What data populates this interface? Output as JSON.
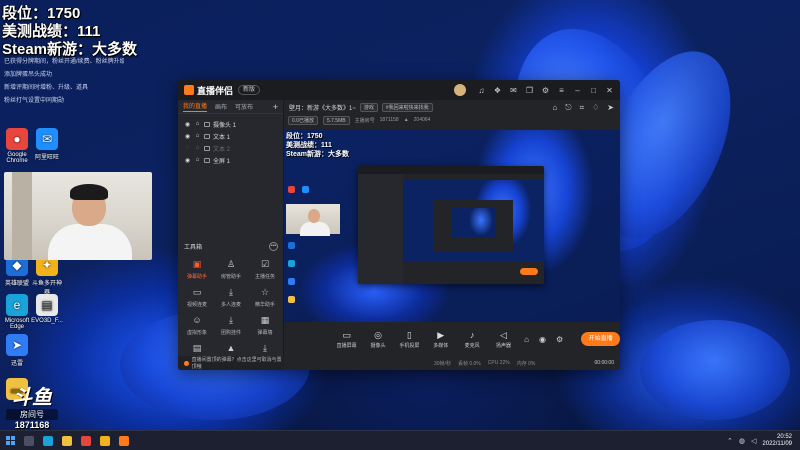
{
  "overlay": {
    "rank": "段位：1750",
    "record": "美测战绩：111",
    "game": "Steam新游：大多数",
    "danmu": [
      "已获得分牌期间，粉丝开通/续费、粉丝牌升级",
      "添加牌蛋吊头成功",
      "新增评期间时增粉、升级、道具",
      "粉丝打气设置中同期勋"
    ]
  },
  "desktop_icons": [
    {
      "label": "Google Chrome",
      "icon": "chrome-icon",
      "color": "#e8453c"
    },
    {
      "label": "阿里旺旺",
      "icon": "chat-icon",
      "color": "#1f8fff"
    },
    {
      "label": "英雄联盟",
      "icon": "game-icon",
      "color": "#1c6ed8"
    },
    {
      "label": "斗鱼多开神器",
      "icon": "fish-icon",
      "color": "#f2b21b"
    },
    {
      "label": "Microsoft Edge",
      "icon": "edge-icon",
      "color": "#1aa3d8"
    },
    {
      "label": "EVO3D_F...",
      "icon": "file-icon",
      "color": "#e8e8e8"
    },
    {
      "label": "迅雷",
      "icon": "bird-icon",
      "color": "#2f7cf5"
    },
    {
      "label": "",
      "icon": "folder-icon",
      "color": "#f0c040"
    }
  ],
  "watermark": {
    "logo": "斗鱼",
    "room_label": "房间号",
    "room_number": "1871168"
  },
  "app": {
    "name": "直播伴侣",
    "version_badge": "新版",
    "tabs": [
      "我的直播",
      "画布",
      "可放布"
    ],
    "sources": [
      {
        "label": "摄像头 1",
        "dim": false
      },
      {
        "label": "文本 1",
        "dim": false
      },
      {
        "label": "文本 2",
        "dim": true
      },
      {
        "label": "全屏 1",
        "dim": false
      }
    ],
    "tools_title": "工具箱",
    "tools": [
      {
        "label": "弹幕助手",
        "icon": "camera-icon",
        "on": true
      },
      {
        "label": "房管助手",
        "icon": "user-icon",
        "on": false
      },
      {
        "label": "主播任务",
        "icon": "task-icon",
        "on": false
      },
      {
        "label": "视频连麦",
        "icon": "video-icon",
        "on": false
      },
      {
        "label": "多人连麦",
        "icon": "download-icon",
        "on": false
      },
      {
        "label": "精华助手",
        "icon": "star-icon",
        "on": false
      },
      {
        "label": "虚拟形象",
        "icon": "avatar-icon",
        "on": false
      },
      {
        "label": "团购挂件",
        "icon": "download-icon",
        "on": false
      },
      {
        "label": "弹幕墙",
        "icon": "wall-icon",
        "on": false
      },
      {
        "label": "",
        "icon": "grid-icon",
        "on": false
      },
      {
        "label": "",
        "icon": "mountain-icon",
        "on": false
      },
      {
        "label": "",
        "icon": "download-icon",
        "on": false
      }
    ],
    "notice": "直播间置顶的弹幕？点击这里可取消与置顶哦",
    "stream_title": "壁月：新游《大多数》1~",
    "category": "游戏",
    "tag": "#我回来啦快来找我",
    "stats": {
      "uptime": "0.0已播放",
      "bitrate": "5.7.5MB",
      "room_label": "主播房号",
      "room_id": "1871158",
      "popularity": "204064"
    },
    "preview_text": [
      "段位：1750",
      "美测战绩：111",
      "Steam新游：大多数"
    ],
    "controls": [
      {
        "label": "直播屏幕",
        "icon": "screen-icon"
      },
      {
        "label": "摄像头",
        "icon": "webcam-icon"
      },
      {
        "label": "手机投屏",
        "icon": "phone-icon"
      },
      {
        "label": "多媒体",
        "icon": "media-icon"
      },
      {
        "label": "麦克风",
        "icon": "mic-icon"
      },
      {
        "label": "扬声器",
        "icon": "speaker-icon"
      }
    ],
    "start_live": "开始直播",
    "status": {
      "fps": "30帧/秒",
      "drop": "丢帧 0.0%",
      "cpu": "CPU 22%",
      "mem": "内存 0%",
      "rec": "00:00:00"
    }
  },
  "taskbar": {
    "time": "20:52",
    "date": "2022/11/09"
  }
}
